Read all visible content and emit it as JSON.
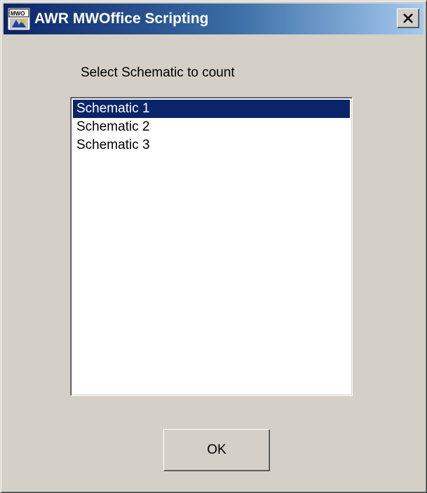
{
  "window": {
    "title": "AWR MWOffice Scripting",
    "icon_name": "mwo-app-icon",
    "close_icon": "close-icon"
  },
  "dialog": {
    "prompt": "Select Schematic to count",
    "schematics": [
      {
        "label": "Schematic 1",
        "selected": true
      },
      {
        "label": "Schematic 2",
        "selected": false
      },
      {
        "label": "Schematic 3",
        "selected": false
      }
    ],
    "ok_label": "OK"
  },
  "colors": {
    "face": "#d4d0c8",
    "title_start": "#0a246a",
    "title_end": "#a6caf0",
    "selection": "#0a246a"
  }
}
